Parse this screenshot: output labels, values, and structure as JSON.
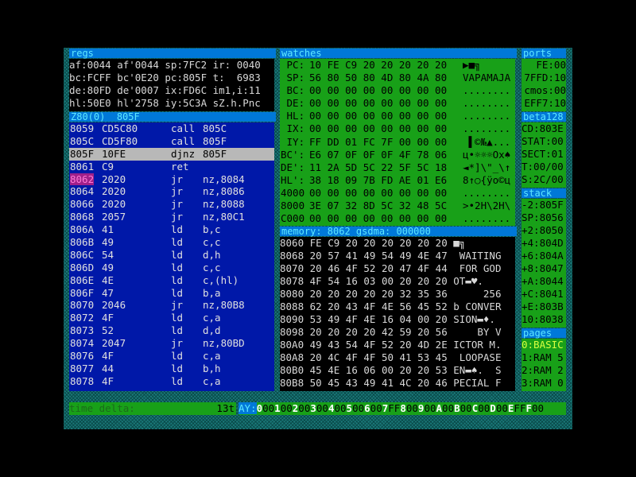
{
  "regs": {
    "title": "regs",
    "lines": [
      "af:0044 af'0044 sp:7FC2 ir: 0040",
      "bc:FCFF bc'0E20 pc:805F t:  6983",
      "de:80FD de'0007 ix:FD6C im1,i:11",
      "hl:50E0 hl'2758 iy:5C3A sZ.h.Pnc"
    ]
  },
  "disasm": {
    "title": "Z80(0)",
    "title2": "805F",
    "rows": [
      {
        "addr": "8059",
        "bytes": "CD5C80",
        "op": "call",
        "arg": "805C"
      },
      {
        "addr": "805C",
        "bytes": "CD5F80",
        "op": "call",
        "arg": "805F"
      },
      {
        "addr": "805F",
        "bytes": "10FE",
        "op": "djnz",
        "arg": "805F",
        "selected": true
      },
      {
        "addr": "8061",
        "bytes": "C9",
        "op": "ret",
        "arg": ""
      },
      {
        "addr": "8062",
        "bytes": "2020",
        "op": "jr",
        "arg": "nz,8084",
        "marked": true
      },
      {
        "addr": "8064",
        "bytes": "2020",
        "op": "jr",
        "arg": "nz,8086"
      },
      {
        "addr": "8066",
        "bytes": "2020",
        "op": "jr",
        "arg": "nz,8088"
      },
      {
        "addr": "8068",
        "bytes": "2057",
        "op": "jr",
        "arg": "nz,80C1"
      },
      {
        "addr": "806A",
        "bytes": "41",
        "op": "ld",
        "arg": "b,c"
      },
      {
        "addr": "806B",
        "bytes": "49",
        "op": "ld",
        "arg": "c,c"
      },
      {
        "addr": "806C",
        "bytes": "54",
        "op": "ld",
        "arg": "d,h"
      },
      {
        "addr": "806D",
        "bytes": "49",
        "op": "ld",
        "arg": "c,c"
      },
      {
        "addr": "806E",
        "bytes": "4E",
        "op": "ld",
        "arg": "c,(hl)"
      },
      {
        "addr": "806F",
        "bytes": "47",
        "op": "ld",
        "arg": "b,a"
      },
      {
        "addr": "8070",
        "bytes": "2046",
        "op": "jr",
        "arg": "nz,80B8"
      },
      {
        "addr": "8072",
        "bytes": "4F",
        "op": "ld",
        "arg": "c,a"
      },
      {
        "addr": "8073",
        "bytes": "52",
        "op": "ld",
        "arg": "d,d"
      },
      {
        "addr": "8074",
        "bytes": "2047",
        "op": "jr",
        "arg": "nz,80BD"
      },
      {
        "addr": "8076",
        "bytes": "4F",
        "op": "ld",
        "arg": "c,a"
      },
      {
        "addr": "8077",
        "bytes": "44",
        "op": "ld",
        "arg": "b,h"
      },
      {
        "addr": "8078",
        "bytes": "4F",
        "op": "ld",
        "arg": "c,a"
      }
    ]
  },
  "watches": {
    "title": "watches",
    "rows": [
      {
        "reg": " PC:",
        "hex": "10 FE C9 20 20 20 20 20",
        "asc": "▶■╗     "
      },
      {
        "reg": " SP:",
        "hex": "56 80 50 80 4D 80 4A 80",
        "asc": "VAPAMAJA"
      },
      {
        "reg": " BC:",
        "hex": "00 00 00 00 00 00 00 00",
        "asc": "........"
      },
      {
        "reg": " DE:",
        "hex": "00 00 00 00 00 00 00 00",
        "asc": "........"
      },
      {
        "reg": " HL:",
        "hex": "00 00 00 00 00 00 00 00",
        "asc": "........"
      },
      {
        "reg": " IX:",
        "hex": "00 00 00 00 00 00 00 00",
        "asc": "........"
      },
      {
        "reg": " IY:",
        "hex": "FF DD 01 FC 7F 00 00 00",
        "asc": " ▌©№▲..."
      },
      {
        "reg": "BC':",
        "hex": "E6 07 0F 0F 0F 4F 78 06",
        "asc": "ц•☼☼☼Ox♠"
      },
      {
        "reg": "DE':",
        "hex": "11 2A 5D 5C 22 5F 5C 18",
        "asc": "◄*]\\\"_\\↑"
      },
      {
        "reg": "HL':",
        "hex": "38 18 09 7B FD AE 01 E6",
        "asc": "8↑○{ÿo©ц"
      },
      {
        "reg": "4000",
        "hex": "00 00 00 00 00 00 00 00",
        "asc": "........"
      },
      {
        "reg": "8000",
        "hex": "3E 07 32 8D 5C 32 48 5C",
        "asc": ">•2H\\2H\\"
      },
      {
        "reg": "C000",
        "hex": "00 00 00 00 00 00 00 00",
        "asc": "........"
      }
    ]
  },
  "memory": {
    "title": "memory: 8062 gsdma: 000000",
    "rows": [
      {
        "addr": "8060",
        "hex": "FE C9 20 20 20 20 20 20",
        "asc": "■╗      "
      },
      {
        "addr": "8068",
        "hex": "20 57 41 49 54 49 4E 47",
        "asc": " WAITING"
      },
      {
        "addr": "8070",
        "hex": "20 46 4F 52 20 47 4F 44",
        "asc": " FOR GOD"
      },
      {
        "addr": "8078",
        "hex": "4F 54 16 03 00 20 20 20",
        "asc": "OT▬♥.   "
      },
      {
        "addr": "8080",
        "hex": "20 20 20 20 20 32 35 36",
        "asc": "     256"
      },
      {
        "addr": "8088",
        "hex": "62 20 43 4F 4E 56 45 52",
        "asc": "b CONVER"
      },
      {
        "addr": "8090",
        "hex": "53 49 4F 4E 16 04 00 20",
        "asc": "SION▬♦. "
      },
      {
        "addr": "8098",
        "hex": "20 20 20 20 42 59 20 56",
        "asc": "    BY V"
      },
      {
        "addr": "80A0",
        "hex": "49 43 54 4F 52 20 4D 2E",
        "asc": "ICTOR M."
      },
      {
        "addr": "80A8",
        "hex": "20 4C 4F 4F 50 41 53 45",
        "asc": " LOOPASE"
      },
      {
        "addr": "80B0",
        "hex": "45 4E 16 06 00 20 20 53",
        "asc": "EN▬♠.  S"
      },
      {
        "addr": "80B8",
        "hex": "50 45 43 49 41 4C 20 46",
        "asc": "PECIAL F"
      }
    ]
  },
  "ports": {
    "title": "ports",
    "lines": [
      "FE:00",
      "7FFD:10",
      "cmos:00",
      "EFF7:10"
    ]
  },
  "beta": {
    "title": "beta128",
    "lines": [
      "CD:803E",
      "STAT:00",
      "SECT:01",
      "T:00/00",
      "S:2C/00"
    ]
  },
  "stack": {
    "title": "stack",
    "lines": [
      "-2:805F",
      "SP:8056",
      "+2:8050",
      "+4:804D",
      "+6:804A",
      "+8:8047",
      "+A:8044",
      "+C:8041",
      "+E:803B",
      "10:8038"
    ]
  },
  "pages": {
    "title": "pages",
    "lines": [
      "0:BASIC",
      "1:RAM 5",
      "2:RAM 2",
      "3:RAM 0"
    ]
  },
  "timedelta": {
    "label": "time delta:",
    "value": "13t"
  },
  "ay": {
    "label": "AY:",
    "cells": [
      [
        "0",
        "00"
      ],
      [
        "1",
        "00"
      ],
      [
        "2",
        "00"
      ],
      [
        "3",
        "00"
      ],
      [
        "4",
        "00"
      ],
      [
        "5",
        "00"
      ],
      [
        "6",
        "00"
      ],
      [
        "7",
        "FF"
      ],
      [
        "8",
        "00"
      ],
      [
        "9",
        "00"
      ],
      [
        "A",
        "00"
      ],
      [
        "B",
        "00"
      ],
      [
        "C",
        "00"
      ],
      [
        "D",
        "00"
      ],
      [
        "E",
        "FF"
      ],
      [
        "F",
        "00"
      ]
    ]
  }
}
